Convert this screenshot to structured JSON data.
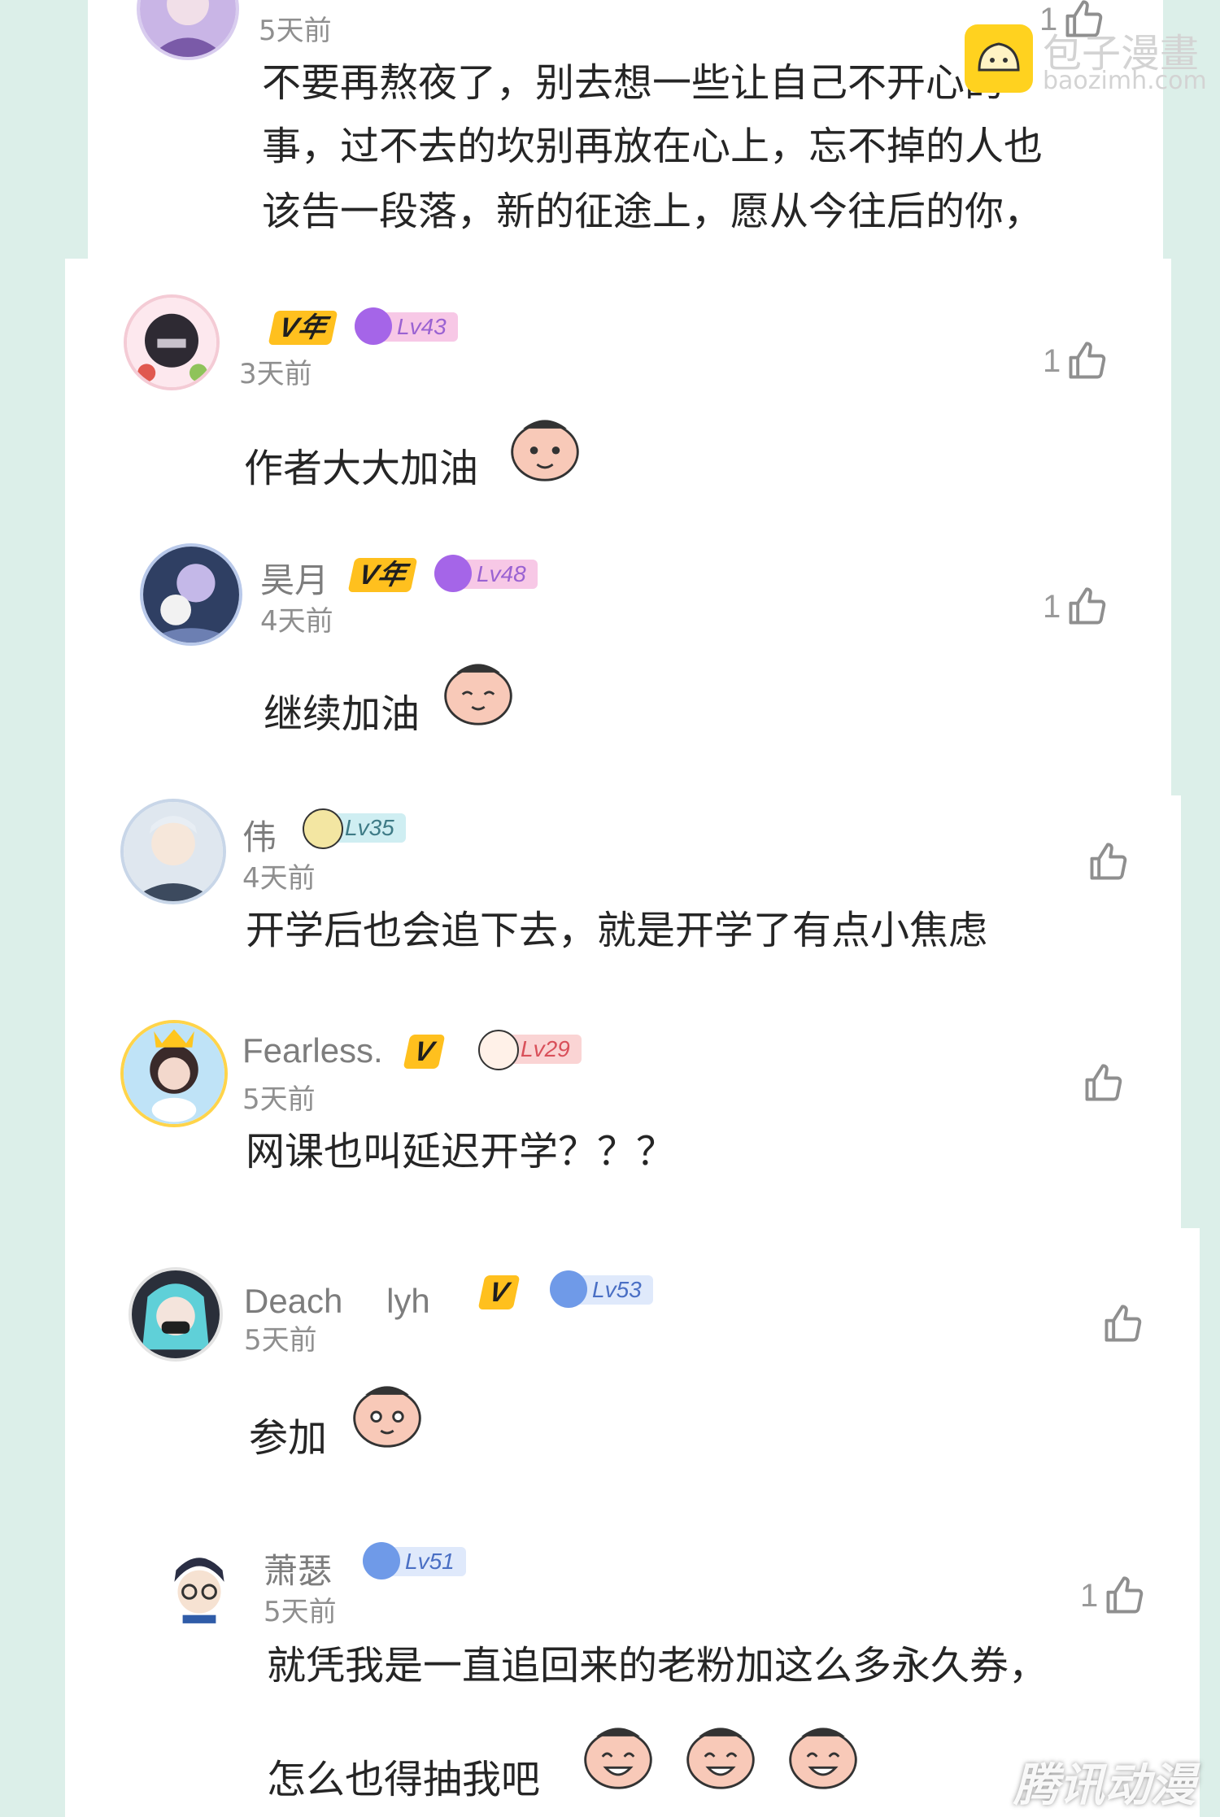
{
  "colors": {
    "page_background": "#dcefe9",
    "vip_badge": "#ffc01e",
    "level_badges": [
      "#f7c8e6",
      "#f7c8e6",
      "#cfeef2",
      "#fad4d4",
      "#dfe9fb",
      "#dfe9fb"
    ]
  },
  "brand": {
    "name": "包子漫畫",
    "url": "baozimh.com",
    "icon": "bun-logo-icon"
  },
  "watermark": "腾讯动漫",
  "comments": [
    {
      "username": "",
      "vip": "",
      "level": "",
      "time": "5天前",
      "likes": "1",
      "lines": [
        "不要再熬夜了，别去想一些让自己不开心的",
        "事，过不去的坎别再放在心上，忘不掉的人也",
        "该告一段落，新的征途上，愿从今往后的你，"
      ],
      "stickers": []
    },
    {
      "username": "",
      "vip": "V年",
      "level": "Lv43",
      "time": "3天前",
      "likes": "1",
      "lines": [
        "作者大大加油"
      ],
      "stickers": [
        "peek-sticker-icon"
      ]
    },
    {
      "username": "昊月",
      "vip": "V年",
      "level": "Lv48",
      "time": "4天前",
      "likes": "1",
      "lines": [
        "继续加油"
      ],
      "stickers": [
        "smile-sticker-icon"
      ]
    },
    {
      "username": "伟",
      "vip": "",
      "level": "Lv35",
      "time": "4天前",
      "likes": "",
      "lines": [
        "开学后也会追下去，就是开学了有点小焦虑"
      ],
      "stickers": []
    },
    {
      "username": "Fearless.",
      "vip": "V",
      "level": "Lv29",
      "time": "5天前",
      "likes": "",
      "lines": [
        "网课也叫延迟开学？？？"
      ],
      "stickers": []
    },
    {
      "username": "Deach　 lyh",
      "vip": "V",
      "level": "Lv53",
      "time": "5天前",
      "likes": "",
      "lines": [
        "参加"
      ],
      "stickers": [
        "peace-sticker-icon"
      ]
    },
    {
      "username": "萧瑟",
      "vip": "",
      "level": "Lv51",
      "time": "5天前",
      "likes": "1",
      "lines": [
        "就凭我是一直追回来的老粉加这么多永久券，",
        "怎么也得抽我吧"
      ],
      "stickers": [
        "grin-sticker-icon",
        "grin-sticker-icon",
        "grin-sticker-icon"
      ]
    }
  ]
}
